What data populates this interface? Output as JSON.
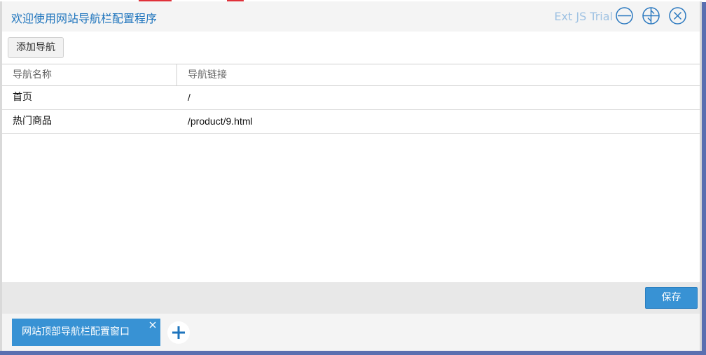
{
  "window": {
    "title": "欢迎使用网站导航栏配置程序",
    "trial_label": "Ext JS Trial",
    "accent_color": "#1e74bd",
    "tools": [
      {
        "name": "minimize-icon"
      },
      {
        "name": "maximize-icon"
      },
      {
        "name": "close-icon"
      }
    ]
  },
  "toolbar": {
    "add_label": "添加导航"
  },
  "grid": {
    "columns": [
      "导航名称",
      "导航链接"
    ],
    "rows": [
      {
        "name": "首页",
        "link": "/"
      },
      {
        "name": "热门商品",
        "link": "/product/9.html"
      }
    ]
  },
  "footer": {
    "save_label": "保存",
    "save_color": "#3892d4"
  },
  "taskbar": {
    "tabs": [
      {
        "label": "网站顶部导航栏配置窗口",
        "close_icon": "close-icon"
      }
    ],
    "add_icon": "plus-icon"
  }
}
